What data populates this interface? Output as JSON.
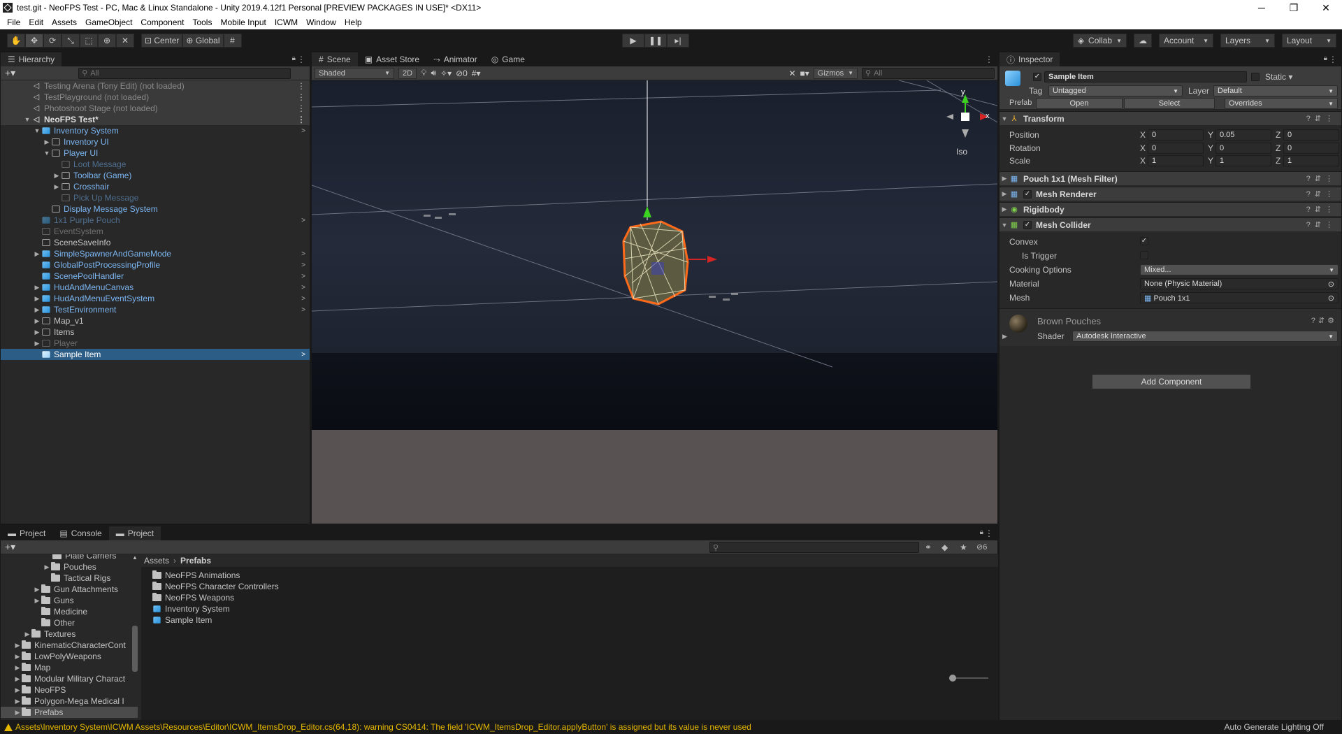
{
  "window": {
    "title": "test.git - NeoFPS Test - PC, Mac & Linux Standalone - Unity 2019.4.12f1 Personal [PREVIEW PACKAGES IN USE]* <DX11>",
    "controls": [
      "─",
      "❐",
      "✕"
    ]
  },
  "menu": [
    "File",
    "Edit",
    "Assets",
    "GameObject",
    "Component",
    "Tools",
    "Mobile Input",
    "ICWM",
    "Window",
    "Help"
  ],
  "toolbar": {
    "pivot": "Center",
    "space": "Global",
    "collab": "Collab",
    "account": "Account",
    "layers": "Layers",
    "layout": "Layout"
  },
  "hierarchy": {
    "tab": "Hierarchy",
    "search_placeholder": "All",
    "rows": [
      {
        "label": "Testing Arena (Tony Edit) (not loaded)"
      },
      {
        "label": "TestPlayground (not loaded)"
      },
      {
        "label": "Photoshoot Stage (not loaded)"
      },
      {
        "label": "NeoFPS Test*"
      },
      {
        "label": "Inventory System"
      },
      {
        "label": "Inventory UI"
      },
      {
        "label": "Player UI"
      },
      {
        "label": "Loot Message"
      },
      {
        "label": "Toolbar (Game)"
      },
      {
        "label": "Crosshair"
      },
      {
        "label": "Pick Up Message"
      },
      {
        "label": "Display Message System"
      },
      {
        "label": "1x1 Purple Pouch"
      },
      {
        "label": "EventSystem"
      },
      {
        "label": "SceneSaveInfo"
      },
      {
        "label": "SimpleSpawnerAndGameMode"
      },
      {
        "label": "GlobalPostProcessingProfile"
      },
      {
        "label": "ScenePoolHandler"
      },
      {
        "label": "HudAndMenuCanvas"
      },
      {
        "label": "HudAndMenuEventSystem"
      },
      {
        "label": "TestEnvironment"
      },
      {
        "label": "Map_v1"
      },
      {
        "label": "Items"
      },
      {
        "label": "Player"
      },
      {
        "label": "Sample Item"
      }
    ]
  },
  "scene": {
    "tabs": [
      "Scene",
      "Asset Store",
      "Animator",
      "Game"
    ],
    "shading": "Shaded",
    "mode_2d": "2D",
    "hidden_count": "0",
    "gizmos": "Gizmos",
    "search_placeholder": "All",
    "gizmo_axes": {
      "x": "x",
      "y": "y"
    },
    "projection": "Iso"
  },
  "inspector": {
    "tab": "Inspector",
    "object_name": "Sample Item",
    "static_label": "Static",
    "tag_label": "Tag",
    "tag_value": "Untagged",
    "layer_label": "Layer",
    "layer_value": "Default",
    "prefab_label": "Prefab",
    "prefab_open": "Open",
    "prefab_select": "Select",
    "prefab_overrides": "Overrides",
    "transform": {
      "title": "Transform",
      "position_label": "Position",
      "rotation_label": "Rotation",
      "scale_label": "Scale",
      "axis_x": "X",
      "axis_y": "Y",
      "axis_z": "Z",
      "position": {
        "x": "0",
        "y": "0.05",
        "z": "0"
      },
      "rotation": {
        "x": "0",
        "y": "0",
        "z": "0"
      },
      "scale": {
        "x": "1",
        "y": "1",
        "z": "1"
      }
    },
    "components": [
      "Pouch 1x1 (Mesh Filter)",
      "Mesh Renderer",
      "Rigidbody",
      "Mesh Collider"
    ],
    "mesh_collider": {
      "convex_label": "Convex",
      "is_trigger_label": "Is Trigger",
      "cooking_label": "Cooking Options",
      "cooking_value": "Mixed...",
      "material_label": "Material",
      "material_value": "None (Physic Material)",
      "mesh_label": "Mesh",
      "mesh_value": "Pouch 1x1"
    },
    "material": {
      "name": "Brown Pouches",
      "shader_label": "Shader",
      "shader_value": "Autodesk Interactive"
    },
    "add_component": "Add Component"
  },
  "project": {
    "tabs": [
      "Project",
      "Console",
      "Project"
    ],
    "hidden_count": "6",
    "tree": [
      {
        "label": "Plate Carriers"
      },
      {
        "label": "Pouches"
      },
      {
        "label": "Tactical Rigs"
      },
      {
        "label": "Gun Attachments"
      },
      {
        "label": "Guns"
      },
      {
        "label": "Medicine"
      },
      {
        "label": "Other"
      },
      {
        "label": "Textures"
      },
      {
        "label": "KinematicCharacterCont"
      },
      {
        "label": "LowPolyWeapons"
      },
      {
        "label": "Map"
      },
      {
        "label": "Modular Military Charact"
      },
      {
        "label": "NeoFPS"
      },
      {
        "label": "Polygon-Mega Medical I"
      },
      {
        "label": "Prefabs"
      }
    ],
    "breadcrumb": [
      "Assets",
      "Prefabs"
    ],
    "items": [
      {
        "label": "NeoFPS Animations",
        "kind": "folder"
      },
      {
        "label": "NeoFPS Character Controllers",
        "kind": "folder"
      },
      {
        "label": "NeoFPS Weapons",
        "kind": "folder"
      },
      {
        "label": "Inventory System",
        "kind": "prefab"
      },
      {
        "label": "Sample Item",
        "kind": "prefab"
      }
    ]
  },
  "status": {
    "warning": "Assets\\Inventory System\\ICWM Assets\\Resources\\Editor\\ICWM_ItemsDrop_Editor.cs(64,18): warning CS0414: The field 'ICWM_ItemsDrop_Editor.applyButton' is assigned but its value is never used",
    "right": "Auto Generate Lighting Off"
  },
  "colors": {
    "accent_blue": "#7cb6f2",
    "selection": "#2c5d87",
    "warning": "#e6b800",
    "panel_bg": "#282828"
  }
}
